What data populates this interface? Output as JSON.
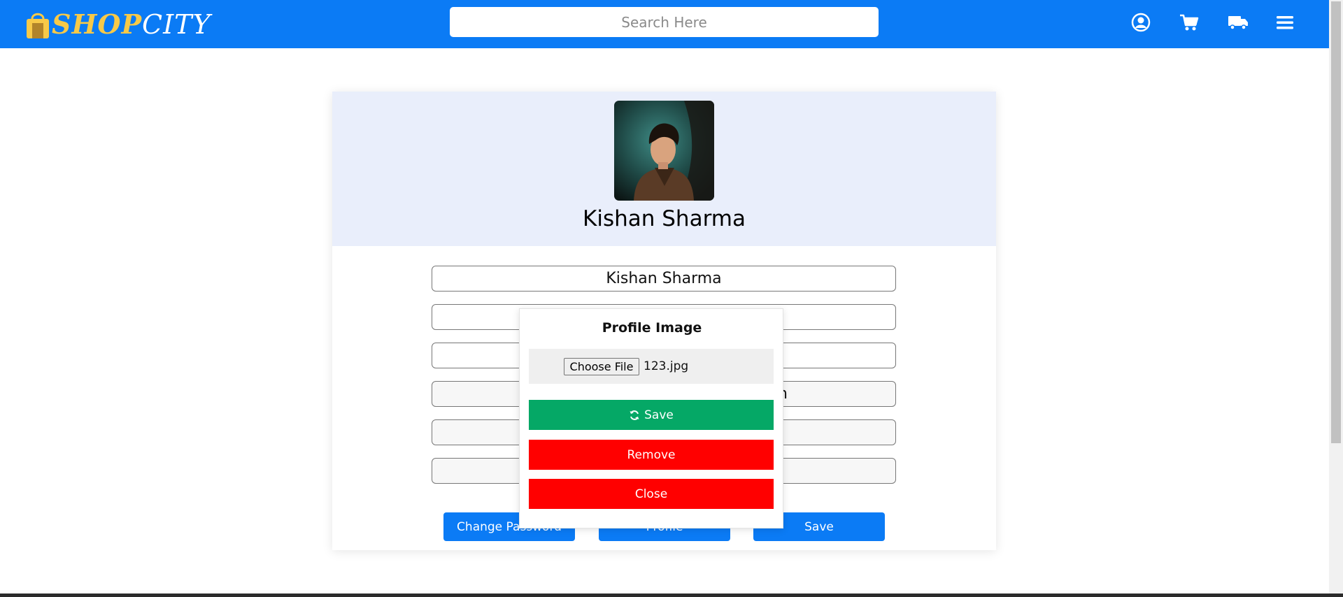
{
  "header": {
    "logo_text_1": "SHOP",
    "logo_text_2": "CITY",
    "search_placeholder": "Search Here",
    "icons": [
      "user-circle-icon",
      "cart-icon",
      "truck-icon",
      "menu-icon"
    ]
  },
  "profile": {
    "name": "Kishan Sharma",
    "fields": [
      {
        "value": "Kishan Sharma"
      },
      {
        "value": ""
      },
      {
        "value": ""
      },
      {
        "value": "n"
      },
      {
        "value": ""
      },
      {
        "value": ""
      }
    ]
  },
  "actions": {
    "change_password": "Change Password",
    "profile": "Profile",
    "save": "Save"
  },
  "modal": {
    "title": "Profile Image",
    "choose_file": "Choose File",
    "file_name": "123.jpg",
    "save": "Save",
    "remove": "Remove",
    "close": "Close"
  },
  "colors": {
    "navbar": "#0b7bf5",
    "save_green": "#05a866",
    "danger_red": "#ff0000",
    "header_panel": "#e9eefb"
  }
}
